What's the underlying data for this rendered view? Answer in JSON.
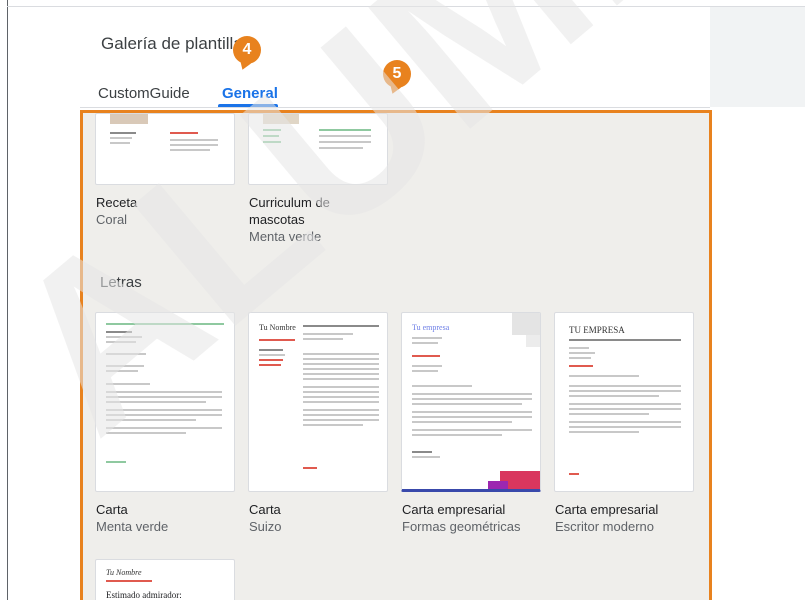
{
  "gallery": {
    "title": "Galería de plantillas",
    "tabs": [
      {
        "label": "CustomGuide"
      },
      {
        "label": "General"
      }
    ]
  },
  "callouts": {
    "tab_marker": "4",
    "area_marker": "5"
  },
  "colors": {
    "accent": "#1a73e8",
    "callout": "#e8821e",
    "panel": "#efeeeb"
  },
  "top_templates": [
    {
      "name": "Receta",
      "style": "Coral"
    },
    {
      "name": "Curriculum de mascotas",
      "name_line1": "Curriculum de",
      "name_line2": "mascotas",
      "style": "Menta verde"
    }
  ],
  "letters_section": {
    "title": "Letras",
    "templates": [
      {
        "name": "Carta",
        "style": "Menta verde"
      },
      {
        "name": "Carta",
        "style": "Suizo"
      },
      {
        "name": "Carta empresarial",
        "style": "Formas geométricas"
      },
      {
        "name": "Carta empresarial",
        "style": "Escritor moderno"
      }
    ]
  },
  "thumbnail_text": {
    "suizo_name": "Tu Nombre",
    "geometric_company": "Tu empresa",
    "modern_company": "TU EMPRESA",
    "last_salutation": "Estimado admirador:"
  },
  "watermark": "ALUMNO"
}
